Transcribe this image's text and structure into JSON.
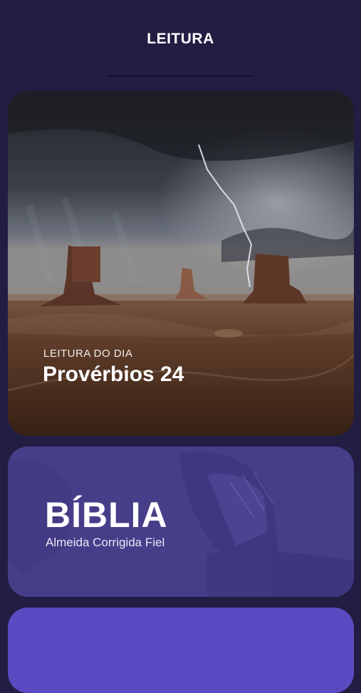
{
  "header": {
    "title": "LEITURA"
  },
  "daily_reading": {
    "kicker": "LEITURA DO DIA",
    "title": "Provérbios 24",
    "image": "desert-storm-monument-valley"
  },
  "bible_card": {
    "title": "BÍBLIA",
    "subtitle": "Almeida Corrigida Fiel",
    "image": "praying-hands-over-bible"
  },
  "colors": {
    "background": "#221d42",
    "bible_card": "#473e8a",
    "third_card": "#5a4bc2"
  }
}
